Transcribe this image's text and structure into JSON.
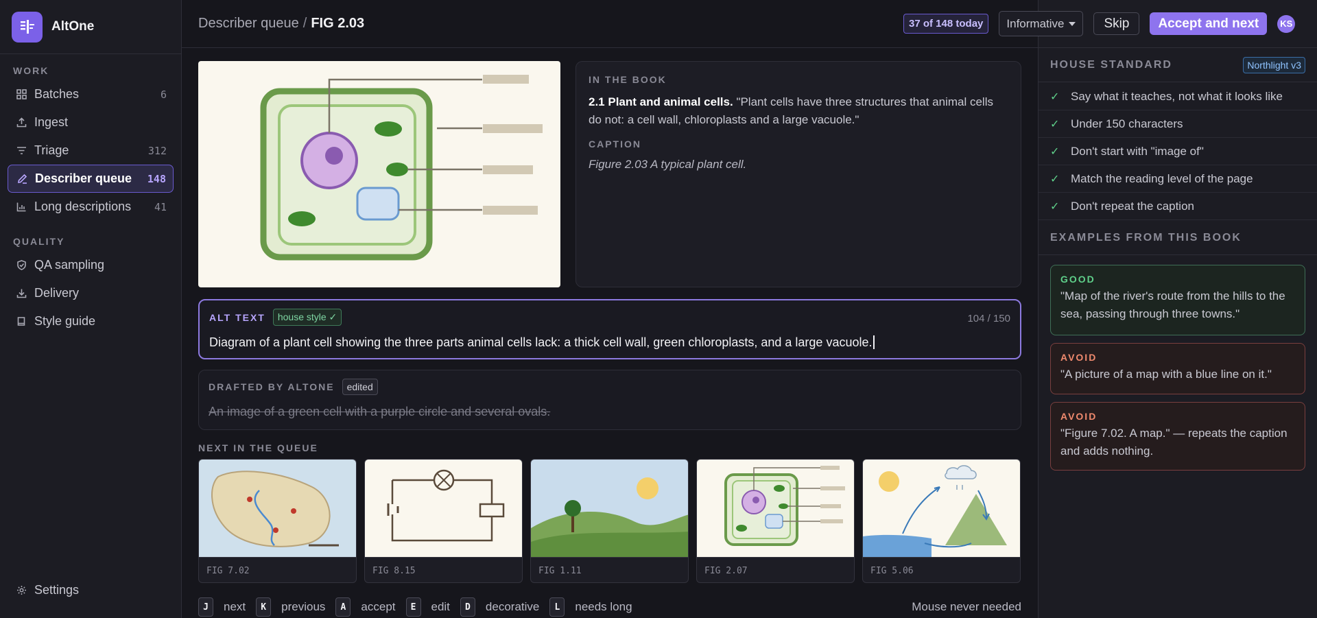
{
  "app": {
    "name": "AltOne"
  },
  "sidebar": {
    "sections": [
      {
        "label": "WORK"
      },
      {
        "label": "QUALITY"
      }
    ],
    "items": [
      {
        "label": "Batches",
        "count": "6"
      },
      {
        "label": "Ingest",
        "count": ""
      },
      {
        "label": "Triage",
        "count": "312"
      },
      {
        "label": "Describer queue",
        "count": "148"
      },
      {
        "label": "Long descriptions",
        "count": "41"
      },
      {
        "label": "QA sampling",
        "count": ""
      },
      {
        "label": "Delivery",
        "count": ""
      },
      {
        "label": "Style guide",
        "count": ""
      }
    ],
    "settings": "Settings"
  },
  "header": {
    "breadcrumb_parent": "Describer queue",
    "breadcrumb_sep": "/",
    "breadcrumb_current": "FIG 2.03",
    "counter": "37 of 148 today",
    "mode_select": "Informative",
    "skip": "Skip",
    "accept": "Accept and next",
    "avatar": "KS"
  },
  "book": {
    "label": "IN THE BOOK",
    "section_title": "2.1 Plant and animal cells.",
    "quote": "\"Plant cells have three structures that animal cells do not: a cell wall, chloroplasts and a large vacuole.\"",
    "caption_label": "CAPTION",
    "caption": "Figure 2.03 A typical plant cell."
  },
  "alt": {
    "label": "ALT TEXT",
    "badge": "house style ✓",
    "count": "104 / 150",
    "value": "Diagram of a plant cell showing the three parts animal cells lack: a thick cell wall, green chloroplasts, and a large vacuole."
  },
  "draft": {
    "label": "DRAFTED BY ALTONE",
    "badge": "edited",
    "value": "An image of a green cell with a purple circle and several ovals."
  },
  "queue": {
    "label": "NEXT IN THE QUEUE",
    "items": [
      {
        "fig": "FIG 7.02"
      },
      {
        "fig": "FIG 8.15"
      },
      {
        "fig": "FIG 1.11"
      },
      {
        "fig": "FIG 2.07"
      },
      {
        "fig": "FIG 5.06"
      }
    ]
  },
  "shortcuts": {
    "items": [
      {
        "key": "J",
        "label": "next"
      },
      {
        "key": "K",
        "label": "previous"
      },
      {
        "key": "A",
        "label": "accept"
      },
      {
        "key": "E",
        "label": "edit"
      },
      {
        "key": "D",
        "label": "decorative"
      },
      {
        "key": "L",
        "label": "needs long"
      }
    ],
    "note": "Mouse never needed"
  },
  "standard": {
    "title": "HOUSE STANDARD",
    "version": "Northlight v3",
    "rules": [
      "Say what it teaches, not what it looks like",
      "Under 150 characters",
      "Don't start with \"image of\"",
      "Match the reading level of the page",
      "Don't repeat the caption"
    ],
    "check": "✓"
  },
  "examples": {
    "title": "EXAMPLES FROM THIS BOOK",
    "items": [
      {
        "tag": "GOOD",
        "text": "\"Map of the river's route from the hills to the sea, passing through three towns.\""
      },
      {
        "tag": "AVOID",
        "text": "\"A picture of a map with a blue line on it.\""
      },
      {
        "tag": "AVOID",
        "text": "\"Figure 7.02. A map.\" — repeats the caption and adds nothing."
      }
    ]
  },
  "colors": {
    "accent": "#8e74ee",
    "good": "#5fd08a",
    "avoid": "#f08a6e"
  }
}
